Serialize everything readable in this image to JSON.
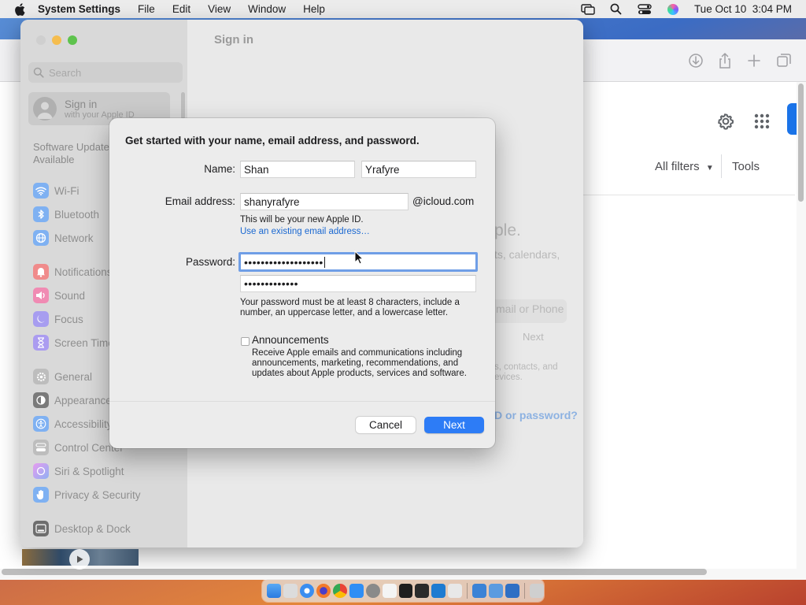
{
  "menubar": {
    "app_name": "System Settings",
    "items": [
      "File",
      "Edit",
      "View",
      "Window",
      "Help"
    ],
    "clock": "Tue Oct 10  3:04 PM"
  },
  "browser": {
    "all_filters": "All filters",
    "tools": "Tools"
  },
  "settings": {
    "title": "Sign in",
    "search_placeholder": "Search",
    "signin_title": "Sign in",
    "signin_subtitle": "with your Apple ID",
    "update_note_line1": "Software Update",
    "update_note_line2": "Available",
    "sidebar_items": [
      {
        "label": "Wi-Fi",
        "color": "#3b8ef0"
      },
      {
        "label": "Bluetooth",
        "color": "#3b8ef0"
      },
      {
        "label": "Network",
        "color": "#3b8ef0"
      },
      {
        "label": "Notifications",
        "color": "#ef4f4f"
      },
      {
        "label": "Sound",
        "color": "#ef4f8e"
      },
      {
        "label": "Focus",
        "color": "#6a5ce0"
      },
      {
        "label": "Screen Time",
        "color": "#7b5ce0"
      },
      {
        "label": "General",
        "color": "#9a9a9a"
      },
      {
        "label": "Appearance",
        "color": "#2c2c2c"
      },
      {
        "label": "Accessibility",
        "color": "#3b8ef0"
      },
      {
        "label": "Control Center",
        "color": "#9a9a9a"
      },
      {
        "label": "Siri & Spotlight",
        "color": "#c95ee0"
      },
      {
        "label": "Privacy & Security",
        "color": "#3b8ef0"
      },
      {
        "label": "Desktop & Dock",
        "color": "#2c2c2c"
      }
    ],
    "faded_heading_tail": "ple.",
    "faded_line": "ts, calendars,",
    "faded_field": "mail or Phone",
    "faded_next": "Next",
    "faded_note_1": "s, contacts, and",
    "faded_note_2": "evices.",
    "faded_link": "D or password?"
  },
  "sheet": {
    "heading": "Get started with your name, email address, and password.",
    "name_label": "Name:",
    "first_name": "Shan",
    "last_name": "Yrafyre",
    "email_label": "Email address:",
    "email_value": "shanyrafyre",
    "email_domain": "@icloud.com",
    "apple_id_note": "This will be your new Apple ID.",
    "use_existing_link": "Use an existing email address…",
    "password_label": "Password:",
    "password_value": "•••••••••••••••••••",
    "verify_value": "•••••••••••••",
    "password_rule_line1": "Your password must be at least 8 characters, include a",
    "password_rule_line2": "number, an uppercase letter, and a lowercase letter.",
    "announcements_label": "Announcements",
    "announcements_checked": false,
    "announcements_desc": "Receive Apple emails and communications including announcements, marketing, recommendations, and updates about Apple products, services and software.",
    "cancel_label": "Cancel",
    "next_label": "Next"
  },
  "colors": {
    "accent": "#2d7cf6",
    "link": "#1a68d1",
    "focus_ring": "#6f9ee6"
  }
}
